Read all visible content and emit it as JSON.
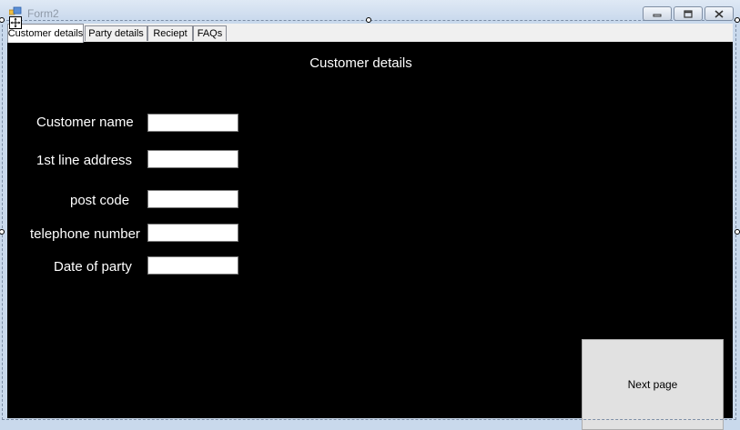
{
  "window": {
    "title": "Form2",
    "icon": "form-icon",
    "controls": [
      "minimize-icon",
      "maximize-icon",
      "close-icon"
    ]
  },
  "tabs": [
    {
      "label": "Customer details",
      "active": true
    },
    {
      "label": "Party details",
      "active": false
    },
    {
      "label": "Reciept",
      "active": false
    },
    {
      "label": "FAQs",
      "active": false
    }
  ],
  "page": {
    "heading": "Customer details",
    "background": "#000000",
    "fields": [
      {
        "label": "Customer name",
        "value": ""
      },
      {
        "label": "1st line address",
        "value": ""
      },
      {
        "label": "post code",
        "value": ""
      },
      {
        "label": "telephone number",
        "value": ""
      },
      {
        "label": "Date of party",
        "value": ""
      }
    ],
    "next_button": "Next page"
  }
}
